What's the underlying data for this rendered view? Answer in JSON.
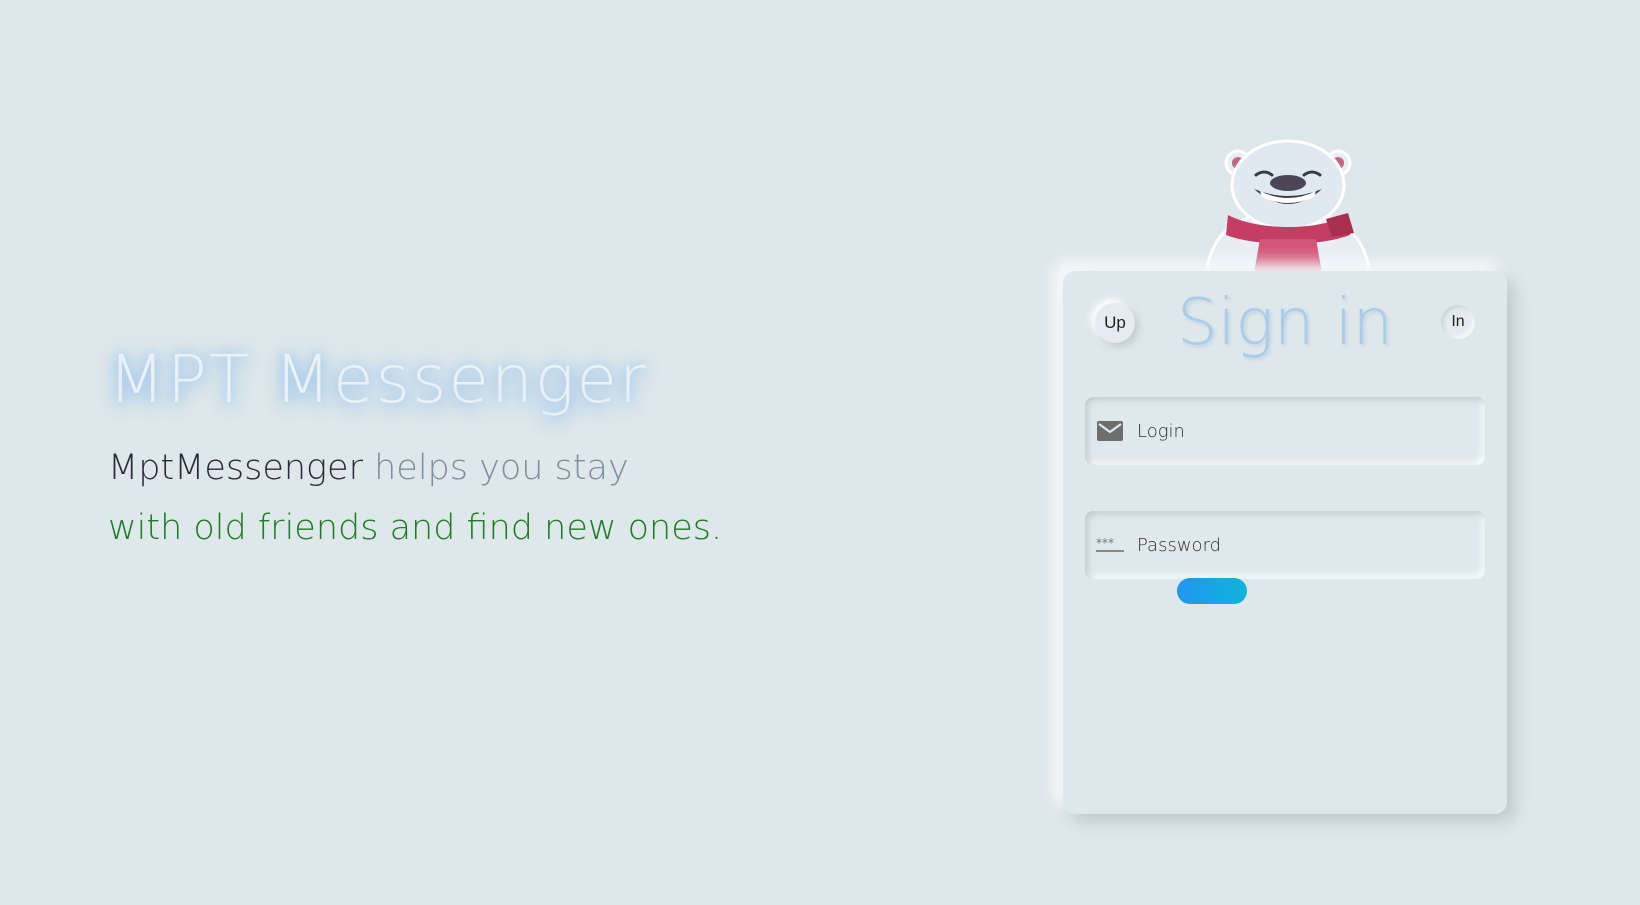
{
  "hero": {
    "title": "MPT Messenger",
    "tagline_brand": "MptMessenger",
    "tagline_rest": " helps you stay",
    "tagline_line2": "with old friends and find new ones."
  },
  "auth_card": {
    "tab_up_label": "Up",
    "tab_in_label": "In",
    "title": "Sign in",
    "login_placeholder": "Login",
    "password_placeholder": "Password",
    "submit_label": ""
  },
  "icons": {
    "login": "mail-icon",
    "password": "password-asterisks-icon",
    "mascot": "polar-bear-mascot"
  },
  "colors": {
    "background": "#dee7ea",
    "title_glow": "#9fc6ec",
    "tagline_dark": "#2a2a3a",
    "tagline_gray": "#7d8f9c",
    "tagline_green": "#1c7d22",
    "card_title": "#a8ccea",
    "button_start": "#2196f3",
    "button_end": "#0fb4d9",
    "scarf": "#c43d63"
  }
}
